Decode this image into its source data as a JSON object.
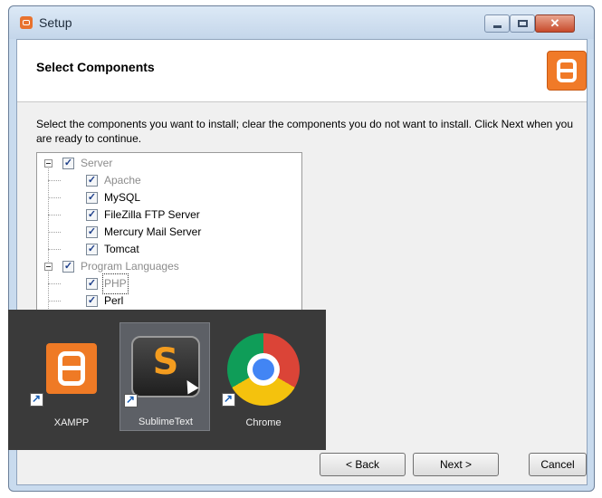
{
  "window": {
    "title": "Setup",
    "close_glyph": "✕",
    "controls": [
      "minimize-icon",
      "maximize-icon",
      "close-icon"
    ]
  },
  "header": {
    "heading": "Select Components",
    "logo_icon": "xampp-logo-icon",
    "accent": "#f07a28"
  },
  "instructions": "Select the components you want to install; clear the components you do not want to install. Click Next when you are ready to continue.",
  "tree": [
    {
      "label": "Server",
      "checked": true,
      "dim": true,
      "group": true
    },
    {
      "label": "Apache",
      "checked": true,
      "dim": true
    },
    {
      "label": "MySQL",
      "checked": true
    },
    {
      "label": "FileZilla FTP Server",
      "checked": true
    },
    {
      "label": "Mercury Mail Server",
      "checked": true
    },
    {
      "label": "Tomcat",
      "checked": true
    },
    {
      "label": "Program Languages",
      "checked": true,
      "dim": true,
      "group": true
    },
    {
      "label": "PHP",
      "checked": true,
      "dim": true,
      "focused": true
    },
    {
      "label": "Perl",
      "checked": true
    }
  ],
  "check_glyph": "✓",
  "buttons": {
    "back": "< Back",
    "next": "Next >",
    "cancel": "Cancel"
  },
  "taskbar_overlay": {
    "tiles": [
      {
        "label": "XAMPP",
        "icon": "xampp-icon"
      },
      {
        "label": "SublimeText",
        "icon": "sublime-text-icon",
        "selected": true,
        "glyph": "S"
      },
      {
        "label": "Chrome",
        "icon": "chrome-icon"
      }
    ]
  }
}
